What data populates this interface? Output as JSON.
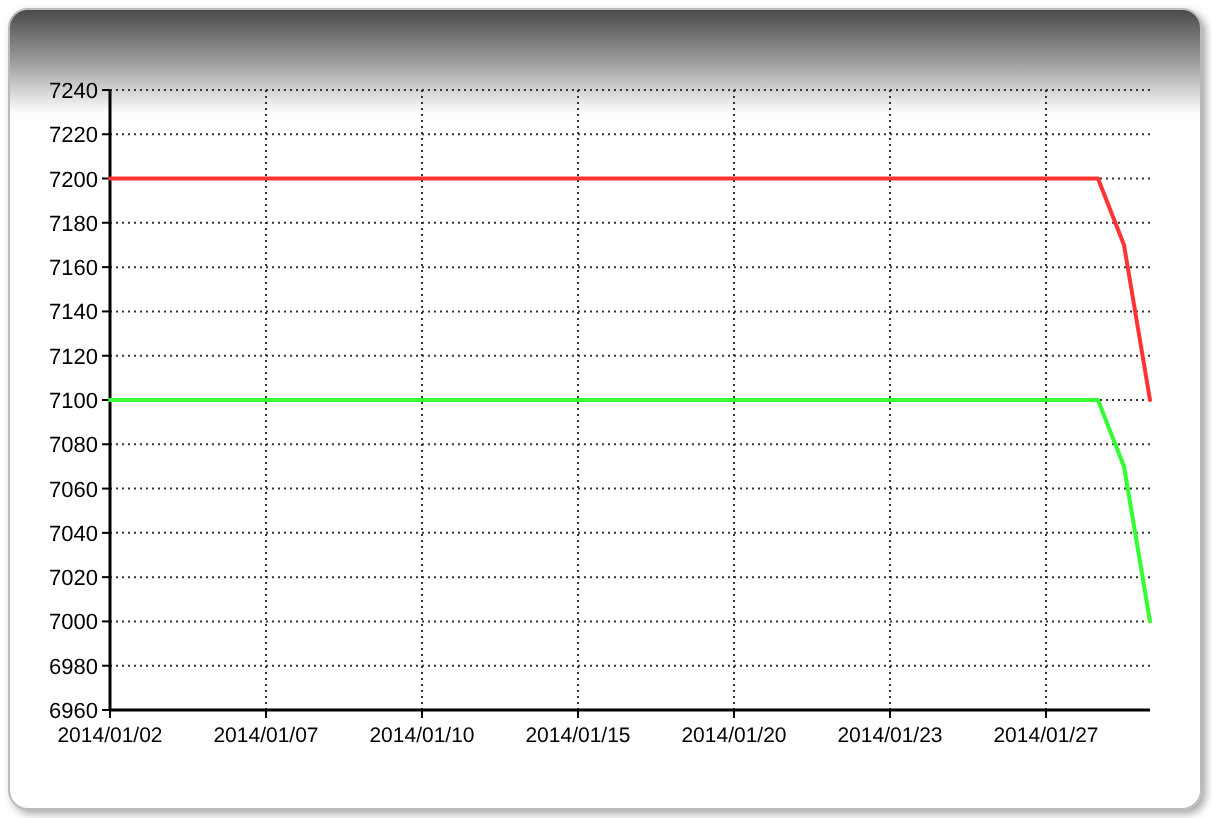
{
  "chart_data": {
    "type": "line",
    "grid": true,
    "categories": [
      "2014/01/02",
      null,
      null,
      null,
      null,
      null,
      "2014/01/07",
      null,
      null,
      null,
      null,
      null,
      "2014/01/10",
      null,
      null,
      null,
      null,
      null,
      "2014/01/15",
      null,
      null,
      null,
      null,
      null,
      "2014/01/20",
      null,
      null,
      null,
      null,
      null,
      "2014/01/23",
      null,
      null,
      null,
      null,
      null,
      "2014/01/27",
      null,
      null,
      null,
      null
    ],
    "ylim": [
      6960,
      7240
    ],
    "yticks": [
      6960,
      6980,
      7000,
      7020,
      7040,
      7060,
      7080,
      7100,
      7120,
      7140,
      7160,
      7180,
      7200,
      7220,
      7240
    ],
    "series": [
      {
        "color": "#ff3333",
        "values": [
          7200,
          7200,
          7200,
          7200,
          7200,
          7200,
          7200,
          7200,
          7200,
          7200,
          7200,
          7200,
          7200,
          7200,
          7200,
          7200,
          7200,
          7200,
          7200,
          7200,
          7200,
          7200,
          7200,
          7200,
          7200,
          7200,
          7200,
          7200,
          7200,
          7200,
          7200,
          7200,
          7200,
          7200,
          7200,
          7200,
          7200,
          7200,
          7200,
          7170,
          7100
        ]
      },
      {
        "color": "#33ff33",
        "values": [
          7100,
          7100,
          7100,
          7100,
          7100,
          7100,
          7100,
          7100,
          7100,
          7100,
          7100,
          7100,
          7100,
          7100,
          7100,
          7100,
          7100,
          7100,
          7100,
          7100,
          7100,
          7100,
          7100,
          7100,
          7100,
          7100,
          7100,
          7100,
          7100,
          7100,
          7100,
          7100,
          7100,
          7100,
          7100,
          7100,
          7100,
          7100,
          7100,
          7070,
          7000
        ]
      }
    ]
  }
}
